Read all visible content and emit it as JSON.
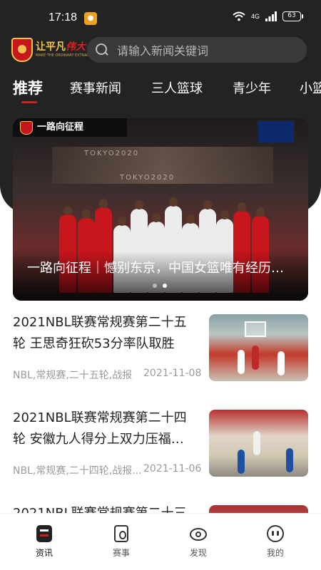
{
  "status_bar": {
    "time": "17:18",
    "network": "4G",
    "battery": "63"
  },
  "header": {
    "logo_text_main": "让平凡",
    "logo_text_accent": "伟大",
    "logo_sub": "MAKE THE ORDINARY EXTRAORDINARY",
    "search_placeholder": "请输入新闻关键词"
  },
  "tabs": [
    {
      "label": "推荐",
      "active": true
    },
    {
      "label": "赛事新闻",
      "active": false
    },
    {
      "label": "三人篮球",
      "active": false
    },
    {
      "label": "青少年",
      "active": false
    },
    {
      "label": "小篮",
      "active": false
    }
  ],
  "banner": {
    "tag": "一路向征程",
    "board_text_1": "TOKYO2020",
    "board_text_2": "TOKYO2020",
    "caption": "一路向征程｜憾别东京，中国女篮唯有经历…",
    "slides": 2,
    "active_slide": 2
  },
  "news": [
    {
      "title": "2021NBL联赛常规赛第二十五轮 王思奇狂砍53分率队取胜",
      "tags": "NBL,常规赛,二十五轮,战报",
      "date": "2021-11-08"
    },
    {
      "title": "2021NBL联赛常规赛第二十四轮  安徽九人得分上双力压福…",
      "tags": "NBL,常规赛,二十四轮,战报...",
      "date": "2021-11-06"
    },
    {
      "title": "2021NBL联赛常规赛第二十三",
      "tags": "",
      "date": ""
    }
  ],
  "bottom_nav": [
    {
      "label": "资讯",
      "icon": "news-icon",
      "active": true
    },
    {
      "label": "赛事",
      "icon": "match-icon",
      "active": false
    },
    {
      "label": "发现",
      "icon": "discover-icon",
      "active": false
    },
    {
      "label": "我的",
      "icon": "me-icon",
      "active": false
    }
  ],
  "colors": {
    "header_bg": "#232323",
    "accent_red": "#d0201f",
    "brand_gold": "#f2c14e"
  }
}
